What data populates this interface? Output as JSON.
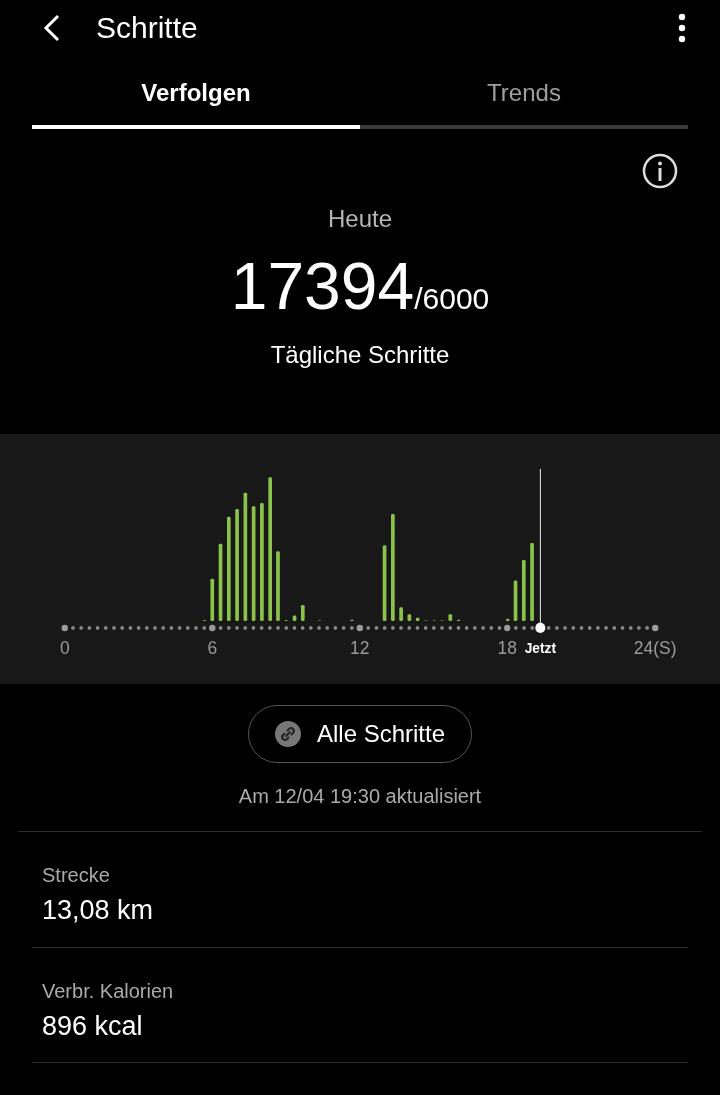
{
  "header": {
    "title": "Schritte"
  },
  "tabs": [
    {
      "label": "Verfolgen",
      "selected": true
    },
    {
      "label": "Trends",
      "selected": false
    }
  ],
  "summary": {
    "period": "Heute",
    "steps": "17394",
    "goal": "/6000",
    "caption": "Tägliche Schritte"
  },
  "chart": {
    "x_labels": [
      "0",
      "6",
      "12",
      "18",
      "24(S)"
    ],
    "now_label": "Jetzt"
  },
  "all_steps_button": "Alle Schritte",
  "updated": "Am 12/04 19:30 aktualisiert",
  "stats": [
    {
      "label": "Strecke",
      "value": "13,08 km"
    },
    {
      "label": "Verbr. Kalorien",
      "value": "896 kcal"
    }
  ]
}
